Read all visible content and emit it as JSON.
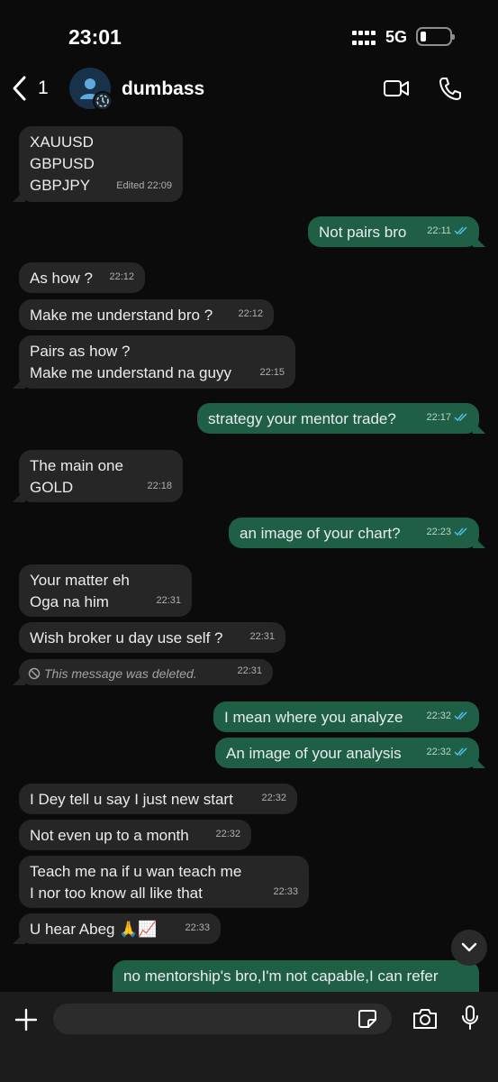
{
  "status_bar": {
    "time": "23:01",
    "network": "5G",
    "battery_level": 0.2
  },
  "header": {
    "back_count": "1",
    "contact_name": "dumbass",
    "icons": {
      "back": "chevron-left-icon",
      "video": "video-camera-icon",
      "call": "phone-icon",
      "avatar": "person-icon"
    }
  },
  "messages": [
    {
      "dir": "in",
      "text": "XAUUSD\nGBPUSD\nGBPJPY",
      "time": "Edited 22:09"
    },
    {
      "dir": "out",
      "text": "Not pairs bro",
      "time": "22:11",
      "read": true
    },
    {
      "dir": "in",
      "text": "As how ?",
      "time": "22:12"
    },
    {
      "dir": "in",
      "text": "Make me understand bro ?",
      "time": "22:12"
    },
    {
      "dir": "in",
      "text": "Pairs as how ?\nMake me understand na guyy",
      "time": "22:15"
    },
    {
      "dir": "out",
      "text": "strategy your mentor trade?",
      "time": "22:17",
      "read": true
    },
    {
      "dir": "in",
      "text": "The main one\nGOLD",
      "time": "22:18"
    },
    {
      "dir": "out",
      "text": "an image of your chart?",
      "time": "22:23",
      "read": true
    },
    {
      "dir": "in",
      "text": "Your matter eh\nOga na him",
      "time": "22:31"
    },
    {
      "dir": "in",
      "text": "Wish broker u day use self ?",
      "time": "22:31"
    },
    {
      "dir": "in",
      "text": "This message was deleted.",
      "time": "22:31",
      "deleted": true
    },
    {
      "dir": "out",
      "text": "I mean where you analyze",
      "time": "22:32",
      "read": true
    },
    {
      "dir": "out",
      "text": "An image of your analysis",
      "time": "22:32",
      "read": true
    },
    {
      "dir": "in",
      "text": "I Dey tell u say I just new start",
      "time": "22:32"
    },
    {
      "dir": "in",
      "text": "Not even up to a month",
      "time": "22:32"
    },
    {
      "dir": "in",
      "text": "Teach me na if u wan teach me\nI nor too know all like that",
      "time": "22:33"
    },
    {
      "dir": "in",
      "text": "U hear Abeg 🙏📈",
      "time": "22:33"
    },
    {
      "dir": "out",
      "text": "no mentorship's bro,I'm not capable,I can refer",
      "time": "",
      "partial": true
    }
  ],
  "composer": {
    "placeholder": "",
    "icons": {
      "attach": "plus-icon",
      "sticker": "sticker-icon",
      "camera": "camera-icon",
      "mic": "microphone-icon",
      "scroll": "chevron-down-icon"
    }
  },
  "colors": {
    "incoming": "#262626",
    "outgoing": "#1e5f46",
    "read_ticks": "#53bdeb",
    "background": "#0b0b0b"
  }
}
